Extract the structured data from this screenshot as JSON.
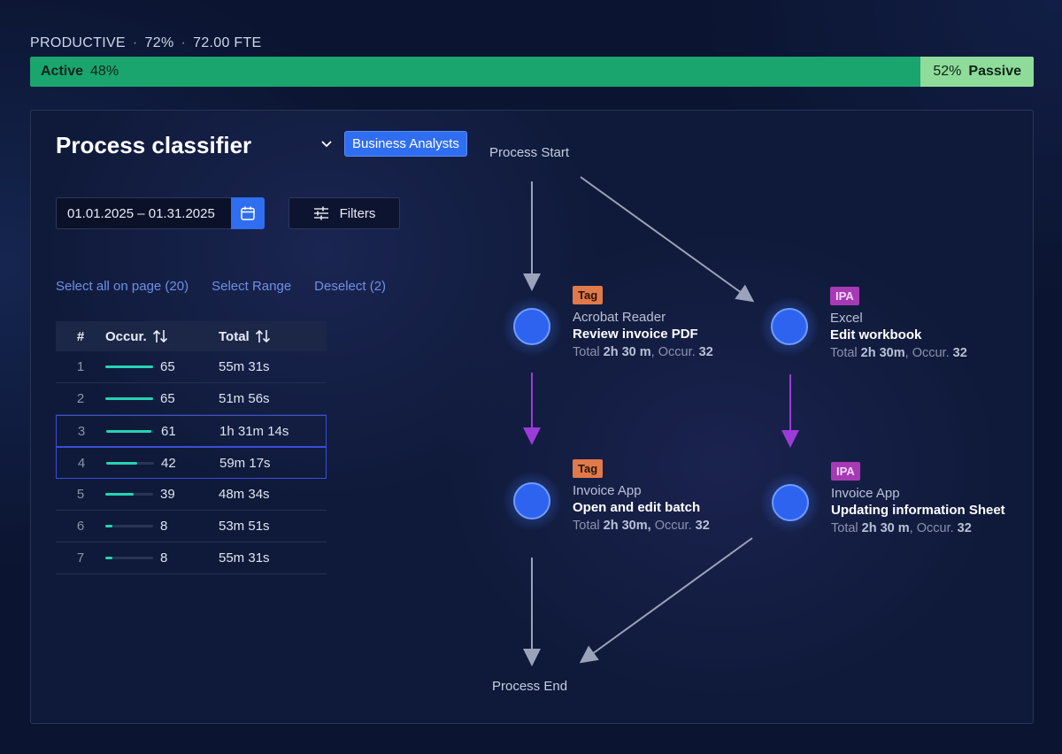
{
  "productivity": {
    "label": "PRODUCTIVE",
    "percent": "72%",
    "fte": "72.00 FTE",
    "active_label": "Active",
    "active_pct": "48%",
    "passive_label": "Passive",
    "passive_pct": "52%",
    "active_fraction": 0.887
  },
  "classifier": {
    "title": "Process classifier",
    "team": "Business Analysts",
    "date_range": "01.01.2025 – 01.31.2025",
    "filters_label": "Filters",
    "select_all": "Select all on page (20)",
    "select_range": "Select Range",
    "deselect": "Deselect (2)"
  },
  "table": {
    "headers": {
      "num": "#",
      "occur": "Occur.",
      "total": "Total"
    },
    "rows": [
      {
        "num": "1",
        "occur": "65",
        "total": "55m 31s",
        "level": 1.0,
        "selected": false
      },
      {
        "num": "2",
        "occur": "65",
        "total": "51m 56s",
        "level": 1.0,
        "selected": false
      },
      {
        "num": "3",
        "occur": "61",
        "total": "1h 31m 14s",
        "level": 0.94,
        "selected": true
      },
      {
        "num": "4",
        "occur": "42",
        "total": "59m 17s",
        "level": 0.65,
        "selected": true
      },
      {
        "num": "5",
        "occur": "39",
        "total": "48m 34s",
        "level": 0.6,
        "selected": false
      },
      {
        "num": "6",
        "occur": "8",
        "total": "53m 51s",
        "level": 0.14,
        "selected": false
      },
      {
        "num": "7",
        "occur": "8",
        "total": "55m 31s",
        "level": 0.14,
        "selected": false
      }
    ]
  },
  "flow": {
    "start": "Process Start",
    "end": "Process End",
    "nodes": [
      {
        "tag": "Tag",
        "app": "Acrobat Reader",
        "task": "Review invoice PDF",
        "total_prefix": "Total ",
        "total": "2h 30 m",
        "occ_prefix": ", Occur. ",
        "occ": "32"
      },
      {
        "tag": "IPA",
        "app": "Excel",
        "task": "Edit workbook",
        "total_prefix": "Total ",
        "total": "2h 30m",
        "occ_prefix": ", Occur. ",
        "occ": "32"
      },
      {
        "tag": "Tag",
        "app": "Invoice App",
        "task": "Open and edit batch",
        "total_prefix": "Total ",
        "total": "2h 30m,",
        "occ_prefix": " Occur. ",
        "occ": "32"
      },
      {
        "tag": "IPA",
        "app": "Invoice App",
        "task": "Updating information Sheet",
        "total_prefix": "Total ",
        "total": "2h 30 m",
        "occ_prefix": ", Occur. ",
        "occ": "32"
      }
    ]
  },
  "colors": {
    "accent": "#2f6ef0",
    "active": "#1aa56f",
    "passive": "#8fdc9a",
    "tag_orange": "#e07a4a",
    "tag_purple": "#a63ab5",
    "occ_bar": "#25d3b4"
  }
}
